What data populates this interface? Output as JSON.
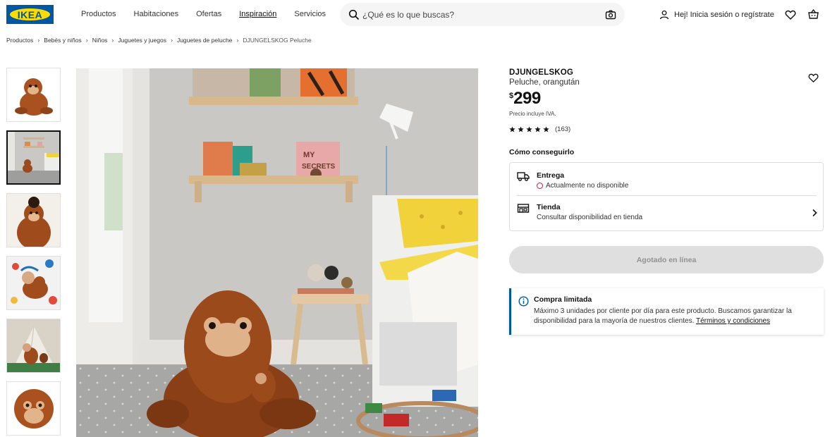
{
  "header": {
    "logo": "IKEA",
    "nav": [
      "Productos",
      "Habitaciones",
      "Ofertas",
      "Inspiración",
      "Servicios"
    ],
    "search_placeholder": "¿Qué es lo que buscas?",
    "user_label": "Hej! Inicia sesión o regístrate"
  },
  "breadcrumb": [
    "Productos",
    "Bebés y niños",
    "Niños",
    "Juguetes y juegos",
    "Juguetes de peluche",
    "DJUNGELSKOG Peluche"
  ],
  "product": {
    "name": "DJUNGELSKOG",
    "description": "Peluche, orangután",
    "currency": "$",
    "price": "299",
    "tax_note": "Precio incluye IVA.",
    "rating": 5,
    "review_count": "(163)"
  },
  "availability": {
    "heading": "Cómo conseguirlo",
    "delivery_title": "Entrega",
    "delivery_status": "Actualmente no disponible",
    "store_title": "Tienda",
    "store_status": "Consultar disponibilidad en tienda"
  },
  "cta": {
    "label": "Agotado en línea"
  },
  "notice": {
    "title": "Compra limitada",
    "text": "Máximo 3 unidades por cliente por día para este producto. Buscamos garantizar la disponibilidad para la mayoría de nuestros clientes.",
    "link": "Términos y condiciones"
  },
  "colors": {
    "ikea_blue": "#0058a3",
    "ikea_yellow": "#ffdb00",
    "unavailable": "#e00751"
  }
}
